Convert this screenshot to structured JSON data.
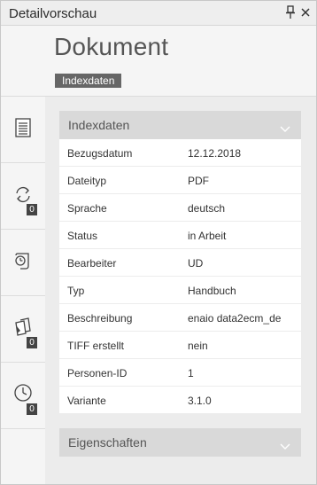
{
  "window": {
    "title": "Detailvorschau",
    "pin_icon": "pin-icon",
    "close_icon": "close-icon"
  },
  "header": {
    "doc_title": "Dokument",
    "tag": "Indexdaten"
  },
  "sidebar": {
    "items": [
      {
        "icon": "index-data-icon",
        "badge": ""
      },
      {
        "icon": "history-icon",
        "badge": "0"
      },
      {
        "icon": "workflow-icon",
        "badge": ""
      },
      {
        "icon": "notes-icon",
        "badge": "0"
      },
      {
        "icon": "clock-icon",
        "badge": "0"
      }
    ]
  },
  "sections": {
    "indexdaten": {
      "label": "Indexdaten",
      "rows": [
        {
          "key": "Bezugsdatum",
          "value": "12.12.2018"
        },
        {
          "key": "Dateityp",
          "value": "PDF"
        },
        {
          "key": "Sprache",
          "value": "deutsch"
        },
        {
          "key": "Status",
          "value": "in Arbeit"
        },
        {
          "key": "Bearbeiter",
          "value": "UD"
        },
        {
          "key": "Typ",
          "value": "Handbuch"
        },
        {
          "key": "Beschreibung",
          "value": "enaio data2ecm_de"
        },
        {
          "key": "TIFF erstellt",
          "value": "nein"
        },
        {
          "key": "Personen-ID",
          "value": "1"
        },
        {
          "key": "Variante",
          "value": "3.1.0"
        }
      ]
    },
    "eigenschaften": {
      "label": "Eigenschaften"
    }
  }
}
